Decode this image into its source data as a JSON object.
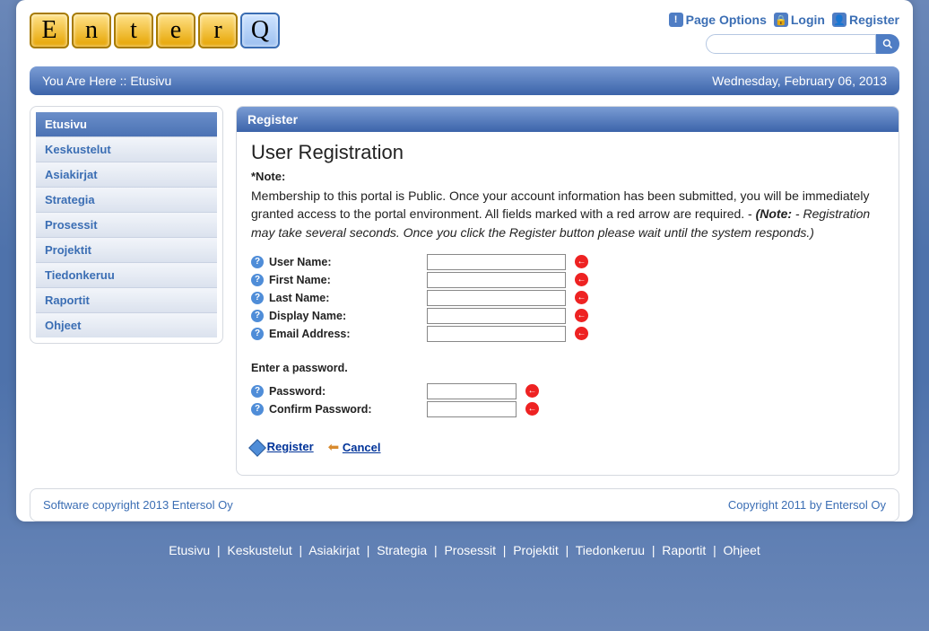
{
  "logo_letters": [
    "E",
    "n",
    "t",
    "e",
    "r",
    "Q"
  ],
  "toplinks": {
    "page_options": "Page Options",
    "login": "Login",
    "register": "Register"
  },
  "breadcrumb": {
    "prefix": "You Are Here ::",
    "current": "Etusivu",
    "date": "Wednesday, February 06, 2013"
  },
  "sidebar": {
    "items": [
      {
        "label": "Etusivu",
        "active": true
      },
      {
        "label": "Keskustelut"
      },
      {
        "label": "Asiakirjat"
      },
      {
        "label": "Strategia"
      },
      {
        "label": "Prosessit"
      },
      {
        "label": "Projektit"
      },
      {
        "label": "Tiedonkeruu"
      },
      {
        "label": "Raportit"
      },
      {
        "label": "Ohjeet"
      }
    ]
  },
  "panel": {
    "title": "Register",
    "heading": "User Registration",
    "note_label": "*Note:",
    "note_text_plain": "Membership to this portal is Public. Once your account information has been submitted, you will be immediately granted access to the portal environment. All fields marked with a red arrow are required. - ",
    "note_text_bold": "(Note:",
    "note_text_italic": " - Registration may take several seconds. Once you click the Register button please wait until the system responds.)",
    "fields": [
      {
        "label": "User Name:",
        "name": "user-name"
      },
      {
        "label": "First Name:",
        "name": "first-name"
      },
      {
        "label": "Last Name:",
        "name": "last-name"
      },
      {
        "label": "Display Name:",
        "name": "display-name"
      },
      {
        "label": "Email Address:",
        "name": "email-address"
      }
    ],
    "password_section_label": "Enter a password.",
    "password_fields": [
      {
        "label": "Password:",
        "name": "password"
      },
      {
        "label": "Confirm Password:",
        "name": "confirm-password"
      }
    ],
    "actions": {
      "register": "Register",
      "cancel": "Cancel"
    }
  },
  "footer": {
    "left": "Software copyright 2013 Entersol Oy",
    "right": "Copyright 2011 by Entersol Oy"
  },
  "bottom_nav": [
    "Etusivu",
    "Keskustelut",
    "Asiakirjat",
    "Strategia",
    "Prosessit",
    "Projektit",
    "Tiedonkeruu",
    "Raportit",
    "Ohjeet"
  ]
}
